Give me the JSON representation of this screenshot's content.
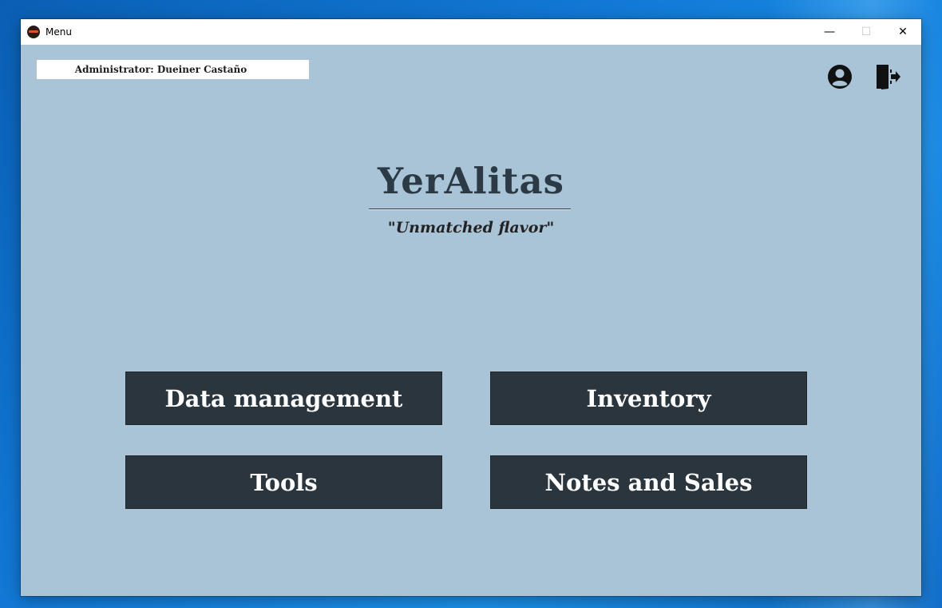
{
  "window": {
    "title": "Menu",
    "controls": {
      "minimize": "—",
      "maximize": "☐",
      "close": "✕"
    }
  },
  "header": {
    "admin_label": "Administrator: Dueiner Castaño",
    "icons": [
      "user-circle-icon",
      "logout-door-icon"
    ]
  },
  "brand": {
    "title": "YerAlitas",
    "tagline": "\"Unmatched flavor\""
  },
  "menu": {
    "data_management": "Data management",
    "inventory": "Inventory",
    "tools": "Tools",
    "notes_and_sales": "Notes and Sales"
  },
  "colors": {
    "window_background": "#a9c4d6",
    "button_background": "#2b353e",
    "button_text": "#ffffff",
    "title_text": "#2b3a45"
  }
}
